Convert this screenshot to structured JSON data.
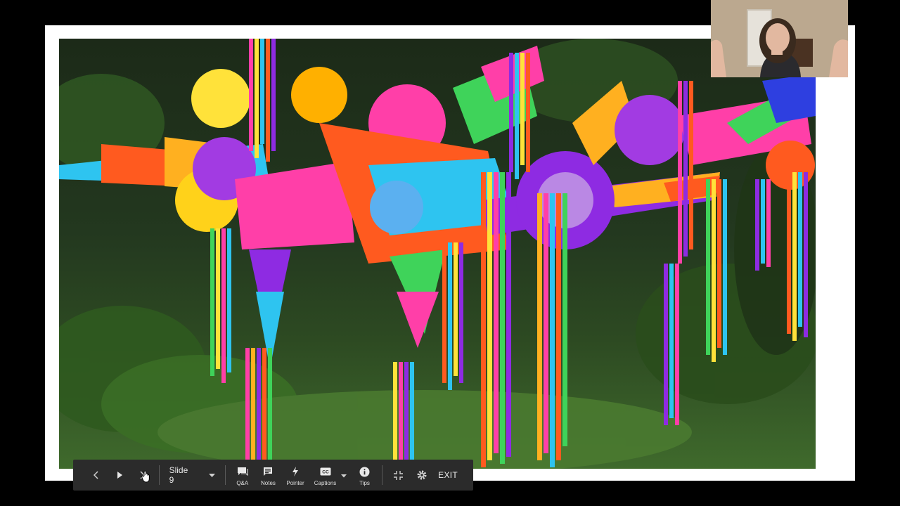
{
  "slide": {
    "image_alt": "Colorful star pinatas with paper streamers hanging over a garden"
  },
  "webcam": {
    "description_icon": "presenter-webcam"
  },
  "toolbar": {
    "prev_icon": "chevron-left-icon",
    "play_icon": "play-icon",
    "next_icon": "chevron-right-icon",
    "slide_label": "Slide 9",
    "qa_label": "Q&A",
    "notes_label": "Notes",
    "pointer_label": "Pointer",
    "captions_label": "Captions",
    "tips_label": "Tips",
    "exit_label": "EXIT"
  },
  "colors": {
    "toolbar_bg": "#2b2b2b",
    "pinata_palette": [
      "#ff3fa8",
      "#ffb020",
      "#2ec4f0",
      "#8e2be2",
      "#ff5a1f",
      "#3fd35a",
      "#ffe23a"
    ]
  }
}
